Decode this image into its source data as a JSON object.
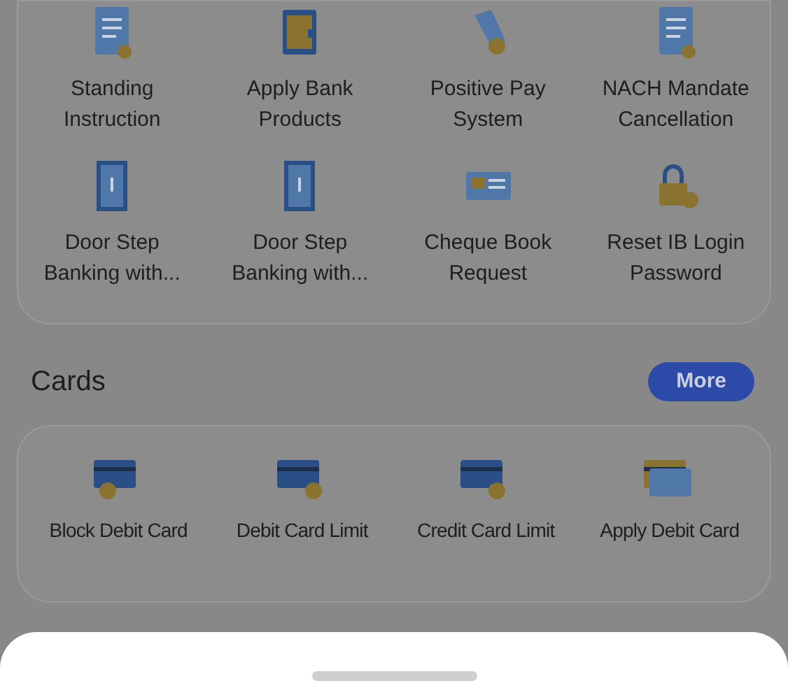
{
  "services": [
    {
      "label": "Standing Instruction"
    },
    {
      "label": "Apply Bank Products"
    },
    {
      "label": "Positive Pay System"
    },
    {
      "label": "NACH Mandate Cancellation"
    },
    {
      "label": "Door Step Banking with..."
    },
    {
      "label": "Door Step Banking with..."
    },
    {
      "label": "Cheque Book Request"
    },
    {
      "label": "Reset IB Login Password"
    }
  ],
  "cards_section": {
    "title": "Cards",
    "more_button": "More",
    "items": [
      {
        "label": "Block Debit Card"
      },
      {
        "label": "Debit Card Limit"
      },
      {
        "label": "Credit Card Limit"
      },
      {
        "label": "Apply Debit Card"
      }
    ]
  }
}
